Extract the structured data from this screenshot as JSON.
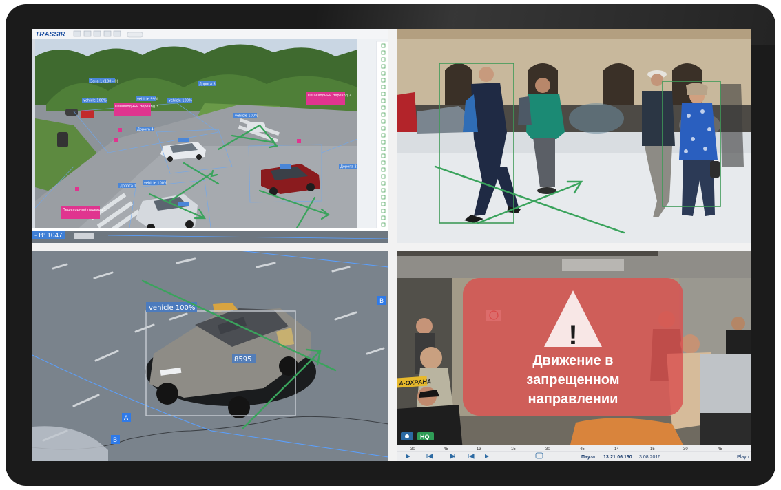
{
  "app": {
    "logo_text": "TRASSIR"
  },
  "q1": {
    "corner_label": "- B: 1047",
    "zone_labels": [
      {
        "id": "z1",
        "text": "Зона 1 (100 - 0)"
      },
      {
        "id": "z2",
        "text": "vehicle 100%"
      },
      {
        "id": "z3",
        "text": "vehicle 99%"
      },
      {
        "id": "z4",
        "text": "vehicle 100%"
      },
      {
        "id": "z5",
        "text": "vehicle 100%"
      },
      {
        "id": "z6",
        "text": "Дорога 4"
      },
      {
        "id": "z7",
        "text": "Дорога 3"
      },
      {
        "id": "z8",
        "text": "Дорога 2"
      },
      {
        "id": "z9",
        "text": "vehicle 100%"
      },
      {
        "id": "z10",
        "text": "Дорога 1"
      }
    ],
    "crossing_labels": [
      {
        "id": "c1",
        "text": "Пешеходный переход 3"
      },
      {
        "id": "c2",
        "text": "Пешеходный переход 2"
      },
      {
        "id": "c3",
        "text": "Пешеходный переход 1"
      }
    ]
  },
  "q3": {
    "detection_label": "vehicle 100%",
    "track_id": "8595",
    "line_a_label": "A",
    "line_b_label": "B",
    "corner_b_label": "B"
  },
  "q4": {
    "warning_symbol": "!",
    "warning_text_lines": [
      "Движение в",
      "запрещенном",
      "направлении"
    ],
    "hq_badge": "HQ",
    "sign_text": "А-ОХРАНА",
    "timeline": {
      "ticks": [
        "30",
        "45",
        "13",
        "15",
        "30",
        "45",
        "14",
        "15",
        "30",
        "45"
      ],
      "status": "Пауза",
      "time": "13:21:06.130",
      "date": "3.08.2016",
      "mode": "Playb"
    }
  },
  "colors": {
    "arrow_green": "#3aa35c",
    "box_green": "#3f9a58",
    "warning_red": "#d9504f",
    "label_blue": "#4a86d8",
    "label_magenta": "#e0348f"
  }
}
